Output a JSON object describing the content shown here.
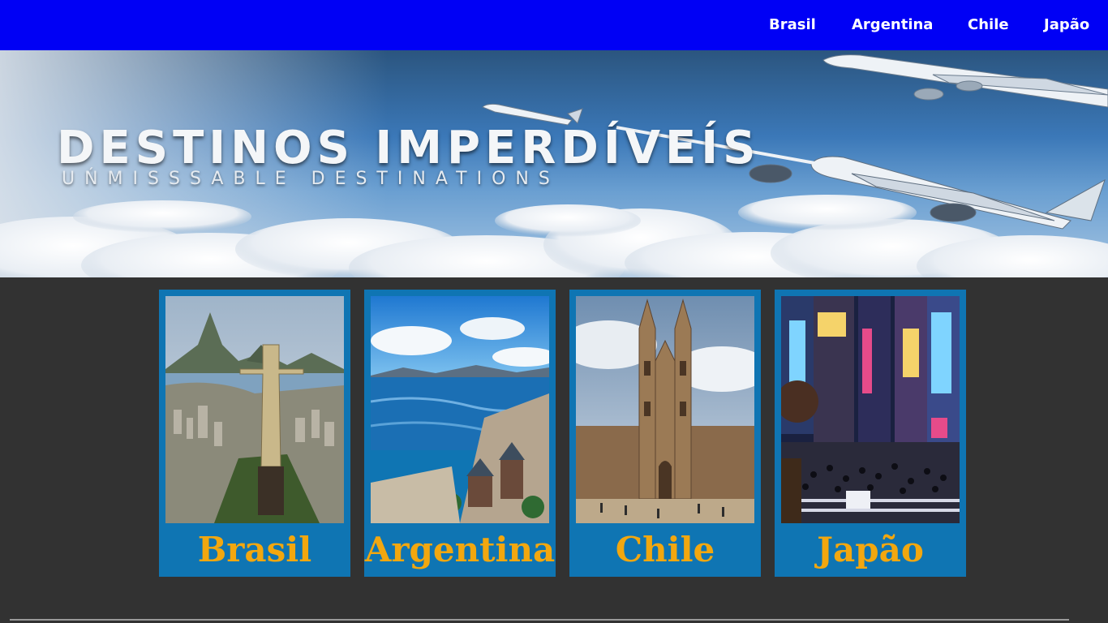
{
  "nav": {
    "links": [
      "Brasil",
      "Argentina",
      "Chile",
      "Japão"
    ]
  },
  "hero": {
    "title": "DESTINOS IMPERDÍVEÍS",
    "subtitle": "UŃMISSSABLE DESTINATIONS"
  },
  "cards": [
    {
      "label": "Brasil",
      "image": "rio-de-janeiro-christ-the-redeemer-photo"
    },
    {
      "label": "Argentina",
      "image": "bariloche-lake-town-photo"
    },
    {
      "label": "Chile",
      "image": "gothic-cathedral-plaza-photo"
    },
    {
      "label": "Japão",
      "image": "tokyo-shibuya-night-crossing-photo"
    }
  ],
  "colors": {
    "nav_background": "#0000f5",
    "page_background": "#323232",
    "card_background": "#0f75b3",
    "card_label": "#f2a70f"
  }
}
